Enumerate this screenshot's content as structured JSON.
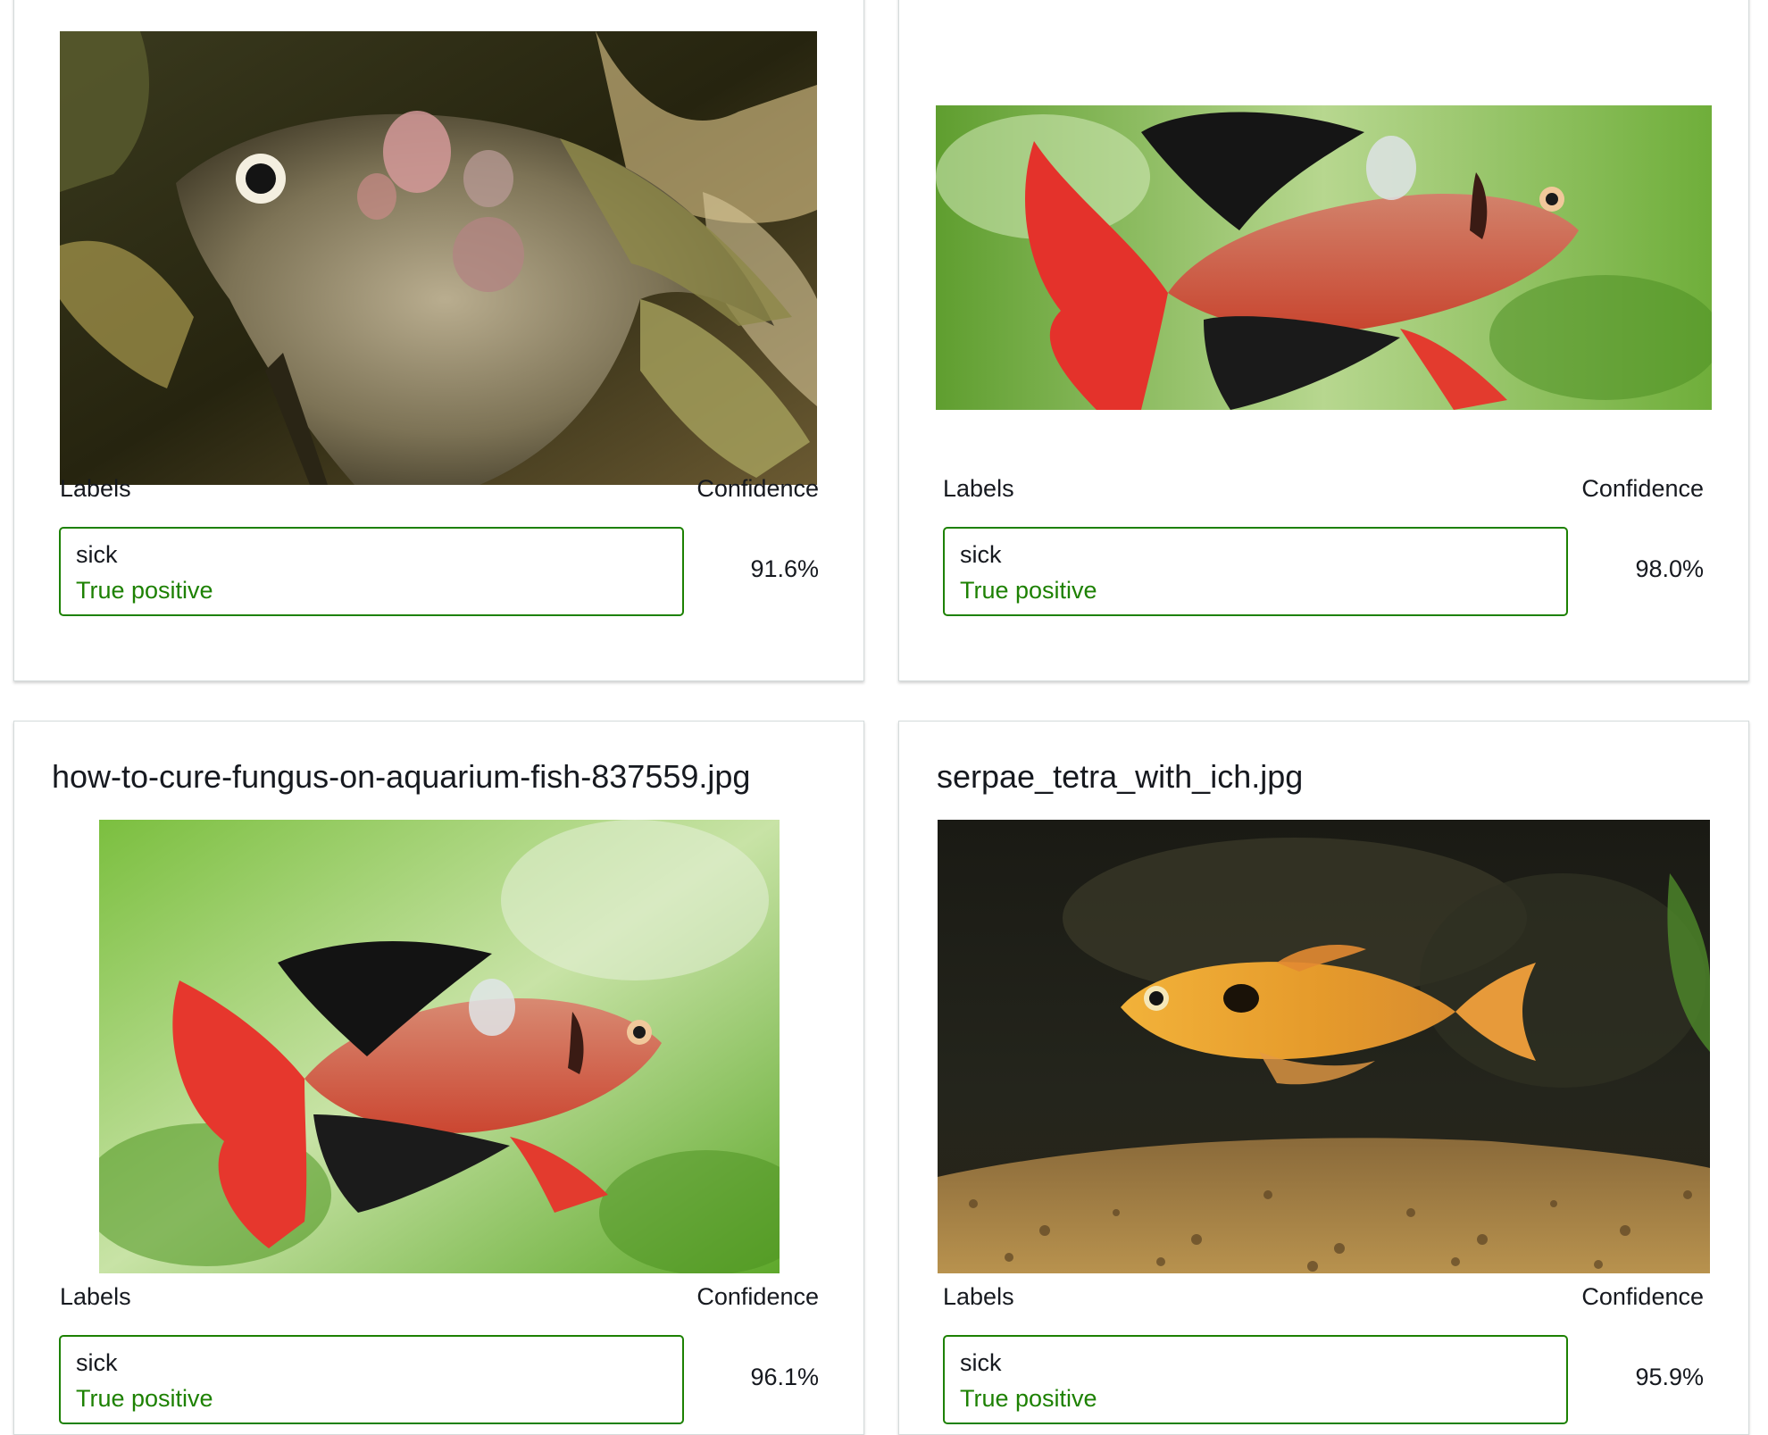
{
  "headers": {
    "labels": "Labels",
    "confidence": "Confidence"
  },
  "colors": {
    "success": "#1d8102",
    "border": "#d5dbdb"
  },
  "cards": [
    {
      "filename": "",
      "image_alt": "angelfish with lesions",
      "label": "sick",
      "status": "True positive",
      "confidence": "91.6%"
    },
    {
      "filename": "",
      "image_alt": "red serpae tetra with white patch",
      "label": "sick",
      "status": "True positive",
      "confidence": "98.0%"
    },
    {
      "filename": "how-to-cure-fungus-on-aquarium-fish-837559.jpg",
      "image_alt": "red tetra with fungus",
      "label": "sick",
      "status": "True positive",
      "confidence": "96.1%"
    },
    {
      "filename": "serpae_tetra_with_ich.jpg",
      "image_alt": "serpae tetra with ich",
      "label": "sick",
      "status": "True positive",
      "confidence": "95.9%"
    }
  ]
}
